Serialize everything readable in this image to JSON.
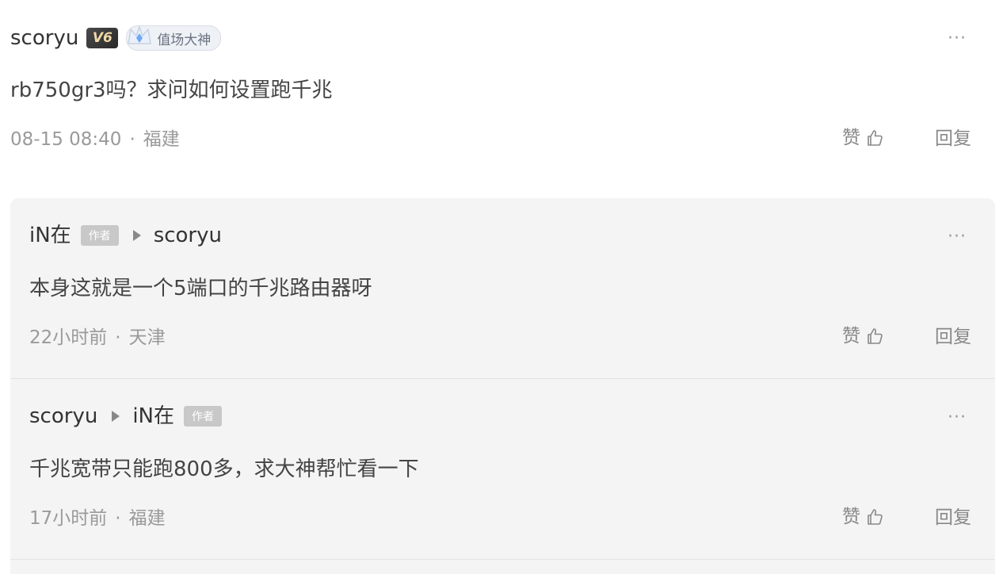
{
  "main_comment": {
    "username": "scoryu",
    "level_badge": "V6",
    "title_badge": "值场大神",
    "text": "rb750gr3吗？求问如何设置跑千兆",
    "time": "08-15 08:40",
    "location": "福建",
    "like_label": "赞",
    "reply_label": "回复",
    "more_label": "···"
  },
  "replies": [
    {
      "from": "iN在",
      "from_badge": "作者",
      "to": "scoryu",
      "to_badge": "",
      "text": "本身这就是一个5端口的千兆路由器呀",
      "time": "22小时前",
      "location": "天津",
      "like_label": "赞",
      "reply_label": "回复",
      "more_label": "···"
    },
    {
      "from": "scoryu",
      "from_badge": "",
      "to": "iN在",
      "to_badge": "作者",
      "text": "千兆宽带只能跑800多，求大神帮忙看一下",
      "time": "17小时前",
      "location": "福建",
      "like_label": "赞",
      "reply_label": "回复",
      "more_label": "···"
    }
  ],
  "separator": "·",
  "colors": {
    "reply_background": "#f4f4f4",
    "author_badge": "#c8c8c8",
    "meta_text": "#9a9a9a"
  }
}
